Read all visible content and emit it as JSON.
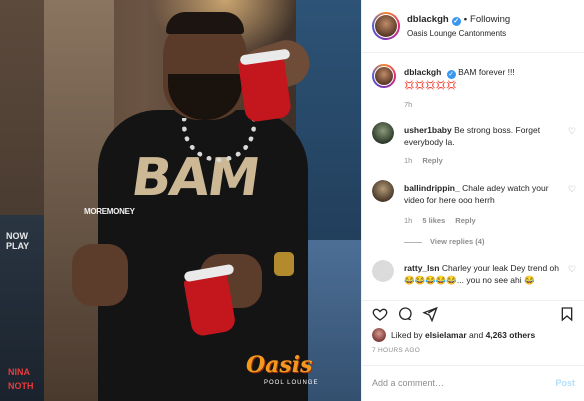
{
  "photo": {
    "poster_top": "NOW\nPLAY",
    "poster_bottom_1": "NINA",
    "poster_bottom_2": "NOTH",
    "shirt_text": "BAM",
    "watermark": "MOREMONEY",
    "logo_main": "Oasis",
    "logo_sub": "POOL LOUNGE"
  },
  "header": {
    "username": "dblackgh",
    "verified": "✓",
    "separator": "•",
    "follow_status": "Following",
    "location": "Oasis Lounge Cantonments"
  },
  "caption": {
    "username": "dblackgh",
    "text": "BAM forever !!! 💢💢💢💢💢",
    "time": "7h"
  },
  "comments": [
    {
      "username": "usher1baby",
      "text": "Be strong boss. Forget everybody la.",
      "time": "1h",
      "reply": "Reply"
    },
    {
      "username": "ballindrippin_",
      "text": "Chale adey watch your video for here ooo herrh",
      "time": "1h",
      "likes": "5 likes",
      "reply": "Reply",
      "view_replies": "View replies (4)"
    },
    {
      "username": "ratty_lsn",
      "text": "Charley your leak Dey trend oh 😂😂😂😂😂... you no see ahi 😂"
    }
  ],
  "likes": {
    "prefix": "Liked by",
    "user": "elsielamar",
    "middle": "and",
    "count": "4,263 others"
  },
  "time_ago": "7 HOURS AGO",
  "add_comment": {
    "placeholder": "Add a comment…",
    "post_label": "Post"
  },
  "colors": {
    "accent": "#3897f0",
    "muted": "#8e8e8e",
    "post_disabled": "#b2dffc"
  }
}
